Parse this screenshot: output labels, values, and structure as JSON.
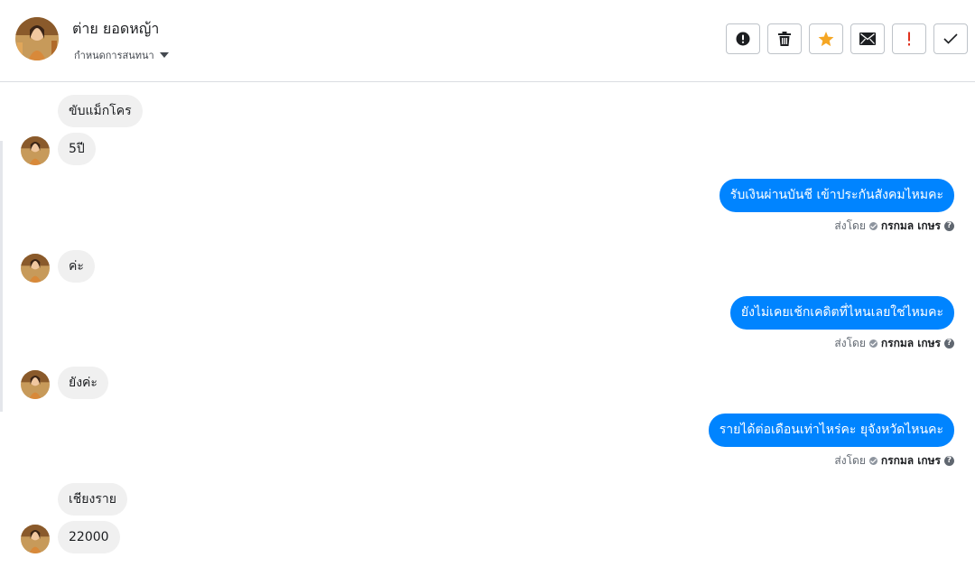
{
  "contact": {
    "name": "ต่าย ยอดหญ้า",
    "subtitle": "กำหนดการสนทนา"
  },
  "toolbar": {
    "icons": [
      "alert-circle-icon",
      "trash-icon",
      "star-icon",
      "envelope-icon",
      "exclamation-icon",
      "check-icon"
    ],
    "star_color": "#f5a623",
    "exclamation_color": "#e0321f"
  },
  "messages": [
    {
      "direction": "in",
      "text": "ขับแม็กโคร"
    },
    {
      "direction": "in",
      "text": "5ปี"
    },
    {
      "direction": "out",
      "text": "รับเงินผ่านบันชี เข้าประกันสังคมไหมคะ",
      "sent_by_label": "ส่งโดย",
      "sender": "กรกมล เกษร"
    },
    {
      "direction": "in",
      "text": "ค่ะ"
    },
    {
      "direction": "out",
      "text": "ยังไม่เคยเช้กเคดิตที่ไหนเลยใช่ไหมคะ",
      "sent_by_label": "ส่งโดย",
      "sender": "กรกมล เกษร"
    },
    {
      "direction": "in",
      "text": "ยังค่ะ"
    },
    {
      "direction": "out",
      "text": "รายได้ต่อเดือนเท่าไหร่คะ ยุจังหวัดไหนคะ",
      "sent_by_label": "ส่งโดย",
      "sender": "กรกมล เกษร"
    },
    {
      "direction": "in",
      "text": "เชียงราย"
    },
    {
      "direction": "in",
      "text": "22000"
    }
  ],
  "colors": {
    "outgoing_bubble": "#0084ff",
    "incoming_bubble": "#f0f0f0"
  }
}
